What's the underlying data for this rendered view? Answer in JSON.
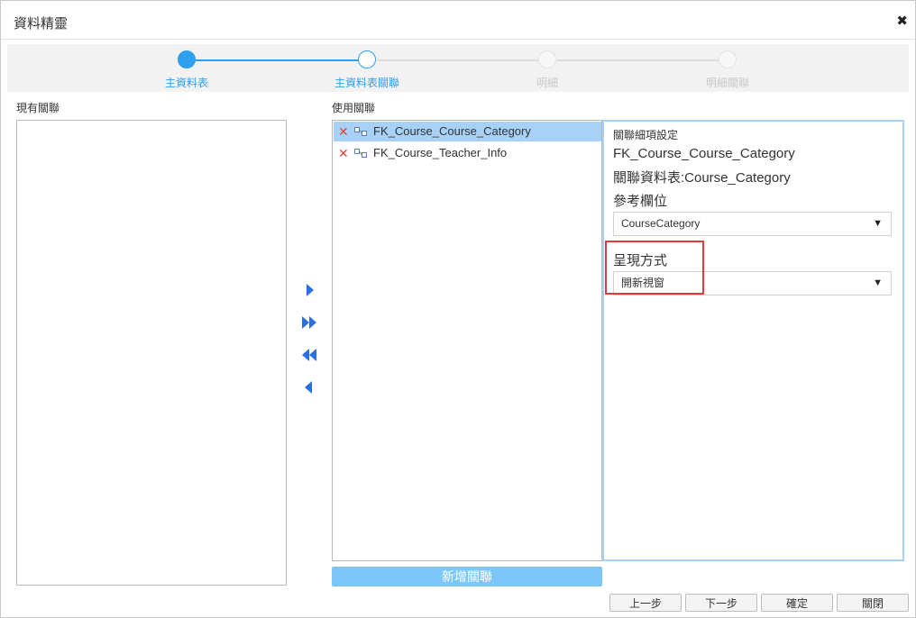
{
  "dialog": {
    "title": "資料精靈"
  },
  "steps": [
    {
      "label": "主資料表",
      "state": "done"
    },
    {
      "label": "主資料表關聯",
      "state": "current"
    },
    {
      "label": "明細",
      "state": "todo"
    },
    {
      "label": "明細關聯",
      "state": "todo"
    }
  ],
  "available": {
    "label": "現有關聯"
  },
  "used": {
    "label": "使用關聯",
    "items": [
      {
        "name": "FK_Course_Course_Category",
        "selected": true
      },
      {
        "name": "FK_Course_Teacher_Info",
        "selected": false
      }
    ]
  },
  "detail": {
    "heading": "關聯細項設定",
    "relation_name": "FK_Course_Course_Category",
    "related_table": "關聯資料表:Course_Category",
    "ref_field_label": "參考欄位",
    "ref_field_value": "CourseCategory",
    "display_label": "呈現方式",
    "display_value": "開新視窗"
  },
  "add_relation_label": "新增關聯",
  "buttons": {
    "prev": "上一步",
    "next": "下一步",
    "confirm": "確定",
    "close": "關閉"
  },
  "colors": {
    "accent": "#2f9ff0",
    "selected": "#a8d1f7",
    "arrow": "#2c6fe0",
    "highlight": "#e03b3b",
    "add_button": "#7dc7f8"
  }
}
